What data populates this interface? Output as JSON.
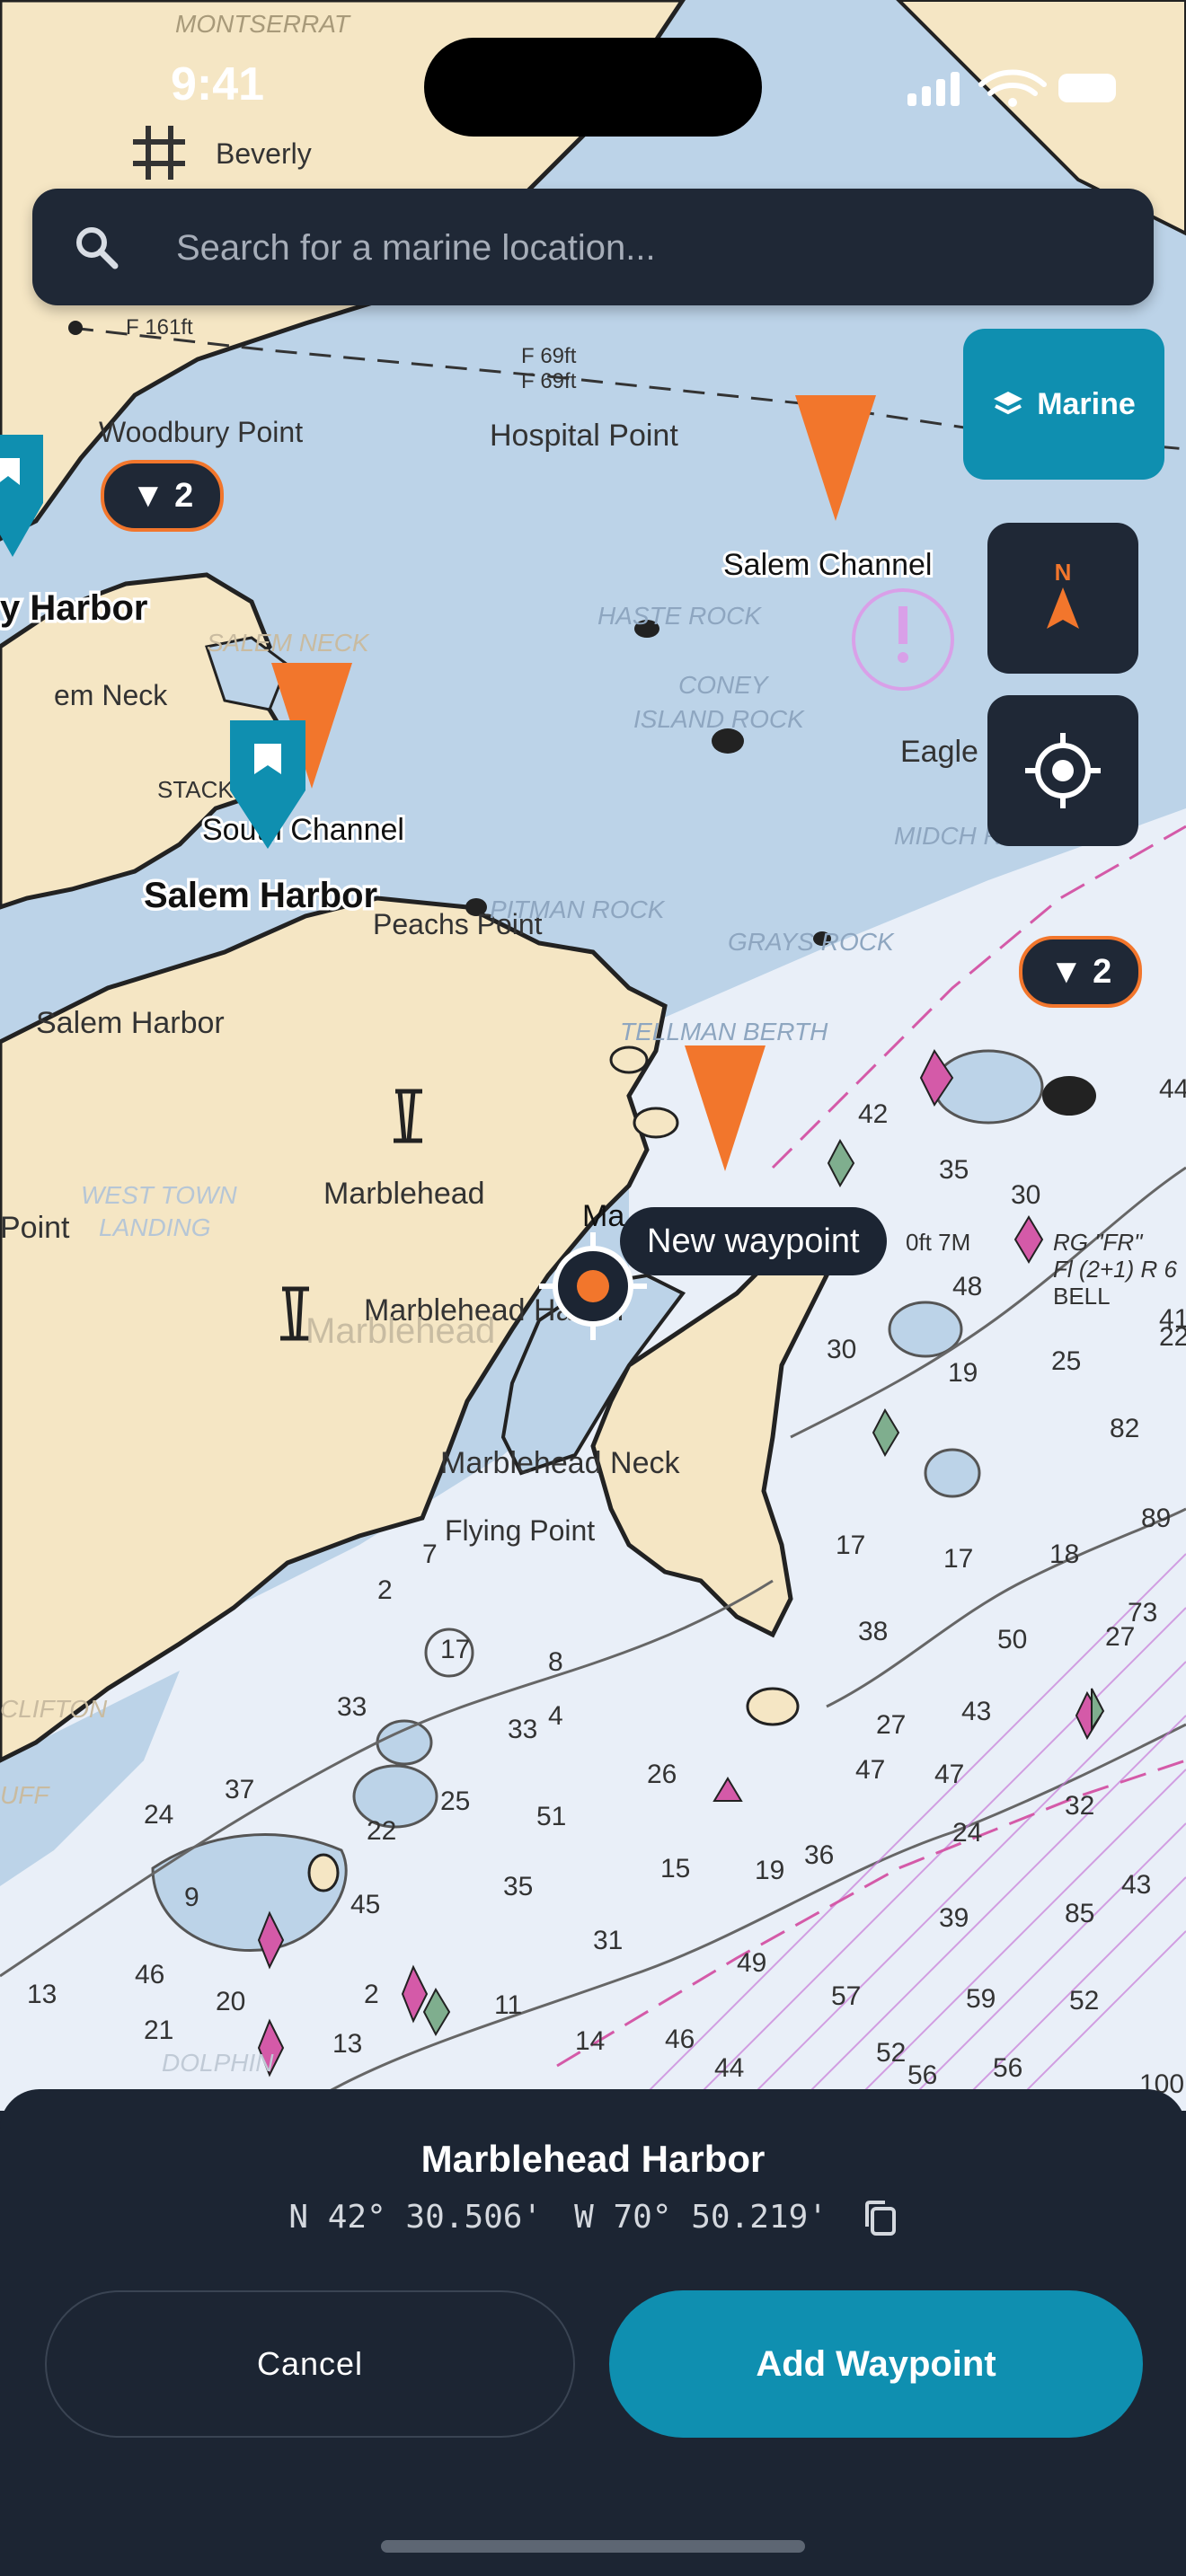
{
  "status": {
    "time": "9:41"
  },
  "search": {
    "placeholder": "Search for a marine location..."
  },
  "controls": {
    "layer_label": "Marine",
    "compass_n": "N"
  },
  "clusters": [
    {
      "label": "▼ 2"
    },
    {
      "label": "▼ 2"
    }
  ],
  "map_labels": {
    "montserrat": "MONTSERRAT",
    "beverly": "Beverly",
    "f161": "F 161ft",
    "f69a": "F 69ft",
    "f69b": "F 69ft",
    "woodbury": "Woodbury Point",
    "hospital": "Hospital Point",
    "salem_channel": "Salem Channel",
    "harbor_left": "y Harbor",
    "salem_neck": "SALEM NECK",
    "neck_partial": "em Neck",
    "haste_rock": "HASTE ROCK",
    "coney": "CONEY",
    "island_rock": "ISLAND ROCK",
    "eagle": "Eagle",
    "stack": "STACK",
    "south_channel": "South Channel",
    "salem_harbor_bold": "Salem Harbor",
    "peachs_point": "Peachs Point",
    "pitman_rock": "PITMAN ROCK",
    "grays_rock": "GRAYS ROCK",
    "midch_rock": "MIDCH ROCK",
    "salem_harbor": "Salem Harbor",
    "tellman_berth": "TELLMAN BERTH",
    "marblehead": "Marblehead",
    "west_town": "WEST TOWN",
    "landing": "LANDING",
    "point_left": "Point",
    "marblehead_harbor_label": "Marblehead Harbor",
    "marblehead_gray": "Marblehead",
    "marblehead_neck": "Marblehead Neck",
    "flying_point": "Flying Point",
    "marblehead_partial": "Ma",
    "bell_text": "BELL",
    "fr_text": "RG \"FR\"",
    "fl_text": "Fl (2+1) R 6",
    "clifton": "CLIFTON",
    "cliff": "UFF",
    "dolph": "DOLPHIN",
    "fl7m": "0ft 7M"
  },
  "depths": [
    "42",
    "35",
    "30",
    "48",
    "19",
    "25",
    "30",
    "82",
    "18",
    "17",
    "17",
    "73",
    "50",
    "27",
    "43",
    "38",
    "27",
    "47",
    "47",
    "32",
    "24",
    "36",
    "19",
    "15",
    "26",
    "51",
    "22",
    "37",
    "24",
    "33",
    "25",
    "33",
    "17",
    "7",
    "2",
    "8",
    "4",
    "9",
    "45",
    "35",
    "31",
    "49",
    "57",
    "59",
    "52",
    "39",
    "85",
    "43",
    "46",
    "44",
    "52",
    "56",
    "56",
    "13",
    "21",
    "20",
    "46",
    "14",
    "11",
    "2",
    "13",
    "100",
    "89",
    "44",
    "22",
    "41"
  ],
  "tooltip": {
    "label": "New waypoint"
  },
  "sheet": {
    "title": "Marblehead Harbor",
    "lat": "N 42° 30.506'",
    "lon": "W 70° 50.219'",
    "cancel": "Cancel",
    "add": "Add Waypoint"
  },
  "colors": {
    "accent": "#0f8fb0",
    "marker_orange": "#f2762c",
    "land": "#f5e6c4",
    "water": "#bcd3e8",
    "shallow": "#e8eef8"
  }
}
